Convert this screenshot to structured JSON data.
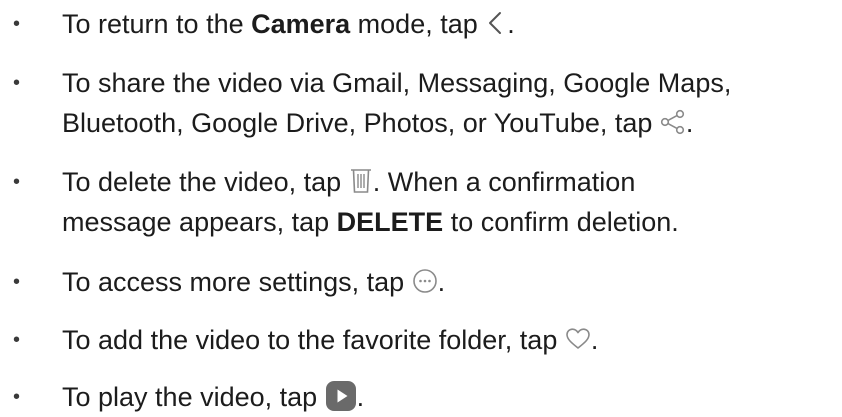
{
  "items": [
    {
      "before": "To return to the ",
      "bold": "Camera",
      "after": " mode, tap ",
      "end": ".",
      "icon": "back-chevron-icon"
    },
    {
      "line1": "To share the video via Gmail, Messaging, Google Maps,",
      "line2": "Bluetooth, Google Drive, Photos, or YouTube, tap ",
      "end": ".",
      "icon": "share-icon"
    },
    {
      "line1_before": "To delete the video, tap ",
      "line1_after": ". When a confirmation",
      "line2_before": "message appears, tap ",
      "line2_bold": "DELETE",
      "line2_after": " to confirm deletion.",
      "icon": "trash-icon"
    },
    {
      "before": "To access more settings, tap ",
      "end": ".",
      "icon": "more-options-icon"
    },
    {
      "before": "To add the video to the favorite folder, tap ",
      "end": ".",
      "icon": "heart-icon"
    },
    {
      "before": "To play the video, tap ",
      "end": ".",
      "icon": "play-icon"
    }
  ],
  "bullet": "•",
  "colors": {
    "text": "#1c1c1c",
    "icon_stroke": "#8a8a8a",
    "play_bg": "#6a6a6a"
  }
}
